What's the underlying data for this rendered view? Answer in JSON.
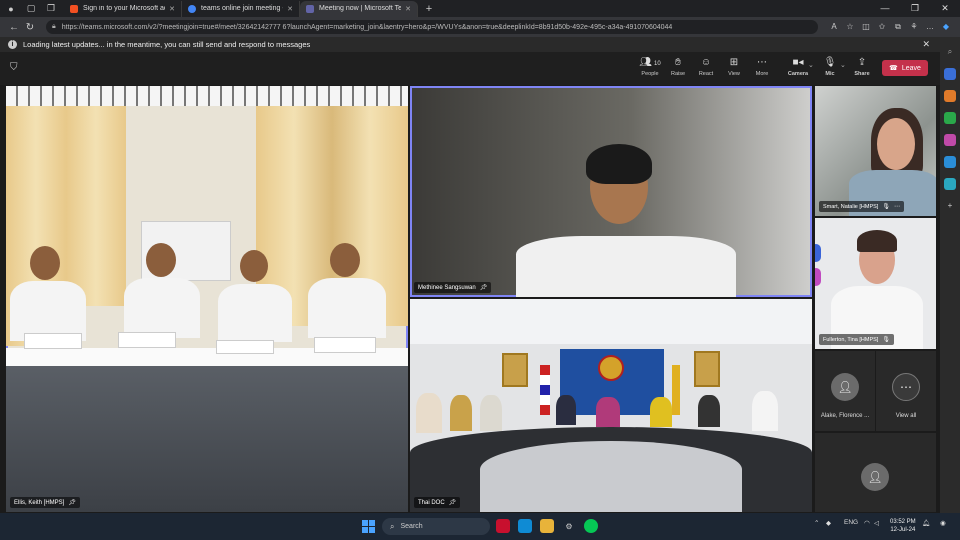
{
  "browser": {
    "tabs": [
      {
        "title": "Sign in to your Microsoft accou...",
        "favicon_color": "#f25022"
      },
      {
        "title": "teams online join meeting - ค้นห...",
        "favicon_color": "#4285f4"
      },
      {
        "title": "Meeting now | Microsoft Teams",
        "favicon_color": "#6264a7"
      }
    ],
    "url": "https://teams.microsoft.com/v2/?meetingjoin=true#/meet/32642142777 6?launchAgent=marketing_join&laentry=hero&p=/WVUYs&anon=true&deeplinkId=8b91d50b-492e-495c-a34a-491070604044"
  },
  "banner": {
    "text": "Loading latest updates... in the meantime, you can still send and respond to messages"
  },
  "toolbar": {
    "people_label": "People",
    "people_count": "10",
    "raise_label": "Raise",
    "react_label": "React",
    "view_label": "View",
    "more_label": "More",
    "camera_label": "Camera",
    "mic_label": "Mic",
    "share_label": "Share",
    "leave_label": "Leave"
  },
  "participants": {
    "main_left": "Ellis, Keith [HMPS]",
    "top_center": "Methinee Sangsuwan",
    "bottom_center": "Thai DOC",
    "side_1": "Smart, Natalie [HMPS]",
    "side_2": "Fullerton, Tina [HMPS]",
    "side_3": "Alake, Florence ...",
    "view_all": "View all"
  },
  "taskbar": {
    "search_placeholder": "Search",
    "lang": "ENG",
    "time": "03:52 PM",
    "date": "12-Jul-24"
  }
}
